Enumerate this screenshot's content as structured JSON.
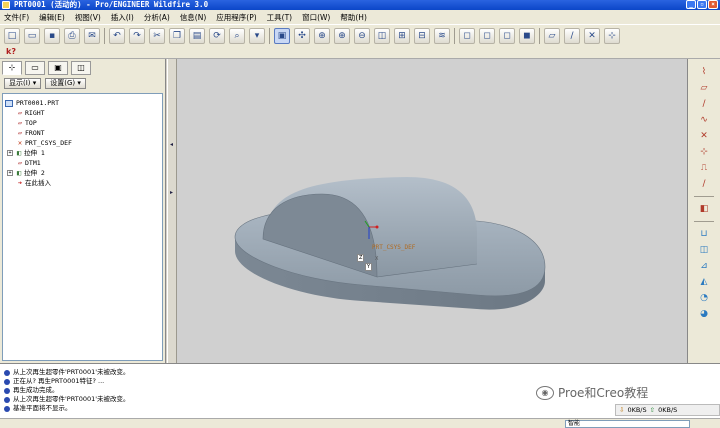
{
  "window": {
    "title": "PRT0001 (活动的) - Pro/ENGINEER Wildfire 3.0",
    "controls": [
      "_",
      "▫",
      "×"
    ]
  },
  "menu": [
    "文件(F)",
    "编辑(E)",
    "视图(V)",
    "插入(I)",
    "分析(A)",
    "信息(N)",
    "应用程序(P)",
    "工具(T)",
    "窗口(W)",
    "帮助(H)"
  ],
  "toolbar_icons": [
    "new-icon",
    "open-icon",
    "save-icon",
    "print-icon",
    "email-icon",
    "undo-icon",
    "redo-icon",
    "cut-icon",
    "copy-icon",
    "paste-icon",
    "regenerate-icon",
    "find-icon",
    "selection-filter-icon",
    "repaint-icon",
    "spin-center-icon",
    "orient-icon",
    "zoom-in-icon",
    "zoom-out-icon",
    "refit-icon",
    "view-manager-icon",
    "saved-views-icon",
    "layers-icon",
    "shading-icon",
    "hidden-line-icon",
    "no-hidden-icon",
    "wireframe-icon",
    "datum-planes-icon",
    "datum-axes-icon",
    "datum-points-icon",
    "csys-icon"
  ],
  "navigator": {
    "tabs": [
      "model-tree-tab",
      "folder-browser-tab",
      "favorites-tab",
      "connections-tab"
    ],
    "show_button": "显示(I) ▾",
    "settings_button": "设置(G) ▾",
    "tree": [
      {
        "label": "PRT0001.PRT",
        "kind": "root",
        "indent": 0
      },
      {
        "label": "RIGHT",
        "kind": "plane",
        "indent": 1
      },
      {
        "label": "TOP",
        "kind": "plane",
        "indent": 1
      },
      {
        "label": "FRONT",
        "kind": "plane",
        "indent": 1
      },
      {
        "label": "PRT_CSYS_DEF",
        "kind": "csys",
        "indent": 1
      },
      {
        "label": "拉伸 1",
        "kind": "feature",
        "indent": 1,
        "expandable": true
      },
      {
        "label": "DTM1",
        "kind": "plane",
        "indent": 1
      },
      {
        "label": "拉伸 2",
        "kind": "feature",
        "indent": 1,
        "expandable": true
      },
      {
        "label": "在此插入",
        "kind": "insert",
        "indent": 1
      }
    ]
  },
  "viewport": {
    "background": "#d0d0d0",
    "model_color": "#8d9aa6",
    "labels": {
      "csys": "PRT_CSYS_DEF",
      "x_axis": "X",
      "y_axis": "Y",
      "z_axis": "Z"
    }
  },
  "right_toolbar_icons": [
    "sketch-icon",
    "plane-icon",
    "axis-icon",
    "curve-icon",
    "point-icon",
    "csys-datum-icon",
    "analysis-icon",
    "sketched-curve-icon",
    "extrude-icon",
    "revolve-icon",
    "variable-section-sweep-icon",
    "boundary-blend-icon",
    "style-icon",
    "hole-icon",
    "shell-icon",
    "rib-icon",
    "draft-icon",
    "round-icon"
  ],
  "messages": [
    "从上次再生超零件'PRT0001'未被改变。",
    "正在从? 再生PRT0001特征? ...",
    "再生成功完成。",
    "从上次再生超零件'PRT0001'未被改变。",
    "基准平面将不显示。"
  ],
  "status": {
    "filter_value": "智能",
    "net_down": "0KB/S",
    "net_up": "0KB/S"
  },
  "watermark": "Proe和Creo教程"
}
